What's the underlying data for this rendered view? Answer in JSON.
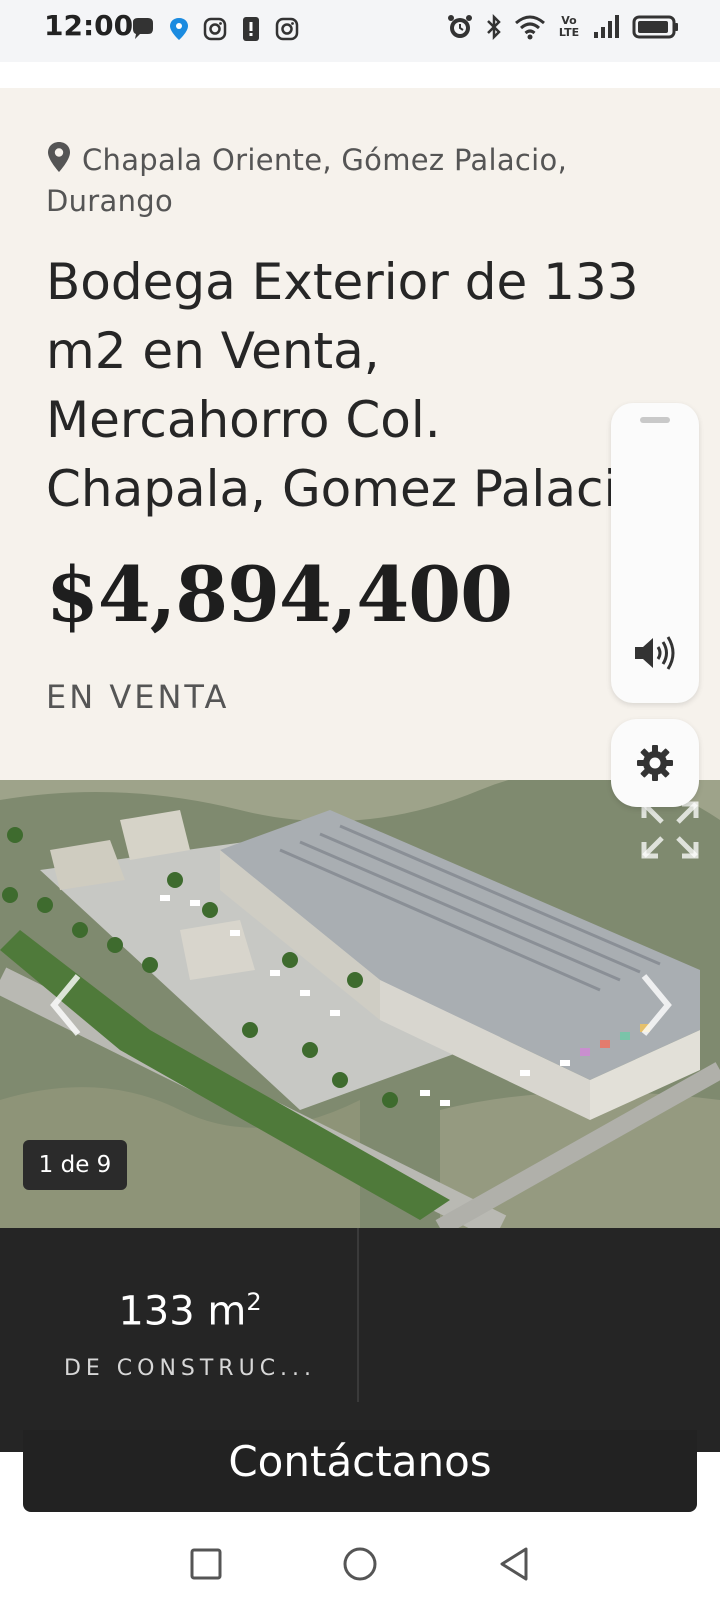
{
  "status_bar": {
    "time": "12:00",
    "left_icons": [
      "chat-icon",
      "location-drop-icon",
      "instagram-icon",
      "alert-icon",
      "instagram-icon"
    ],
    "right_icons": [
      "alarm-icon",
      "bluetooth-icon",
      "wifi-icon",
      "volte-icon",
      "signal-icon",
      "battery-icon"
    ],
    "volte_label": "Vo LTE"
  },
  "listing": {
    "location": "Chapala Oriente, Gómez Palacio, Durango",
    "title": "Bodega Exterior de 133 m2 en Venta, Mercahorro Col. Chapala, Gomez Palacio",
    "price": "$4,894,400",
    "status": "EN VENTA"
  },
  "gallery": {
    "counter": "1 de 9"
  },
  "stats": {
    "value_number": "133 m",
    "value_unit_sup": "2",
    "label": "DE CONSTRUC..."
  },
  "contact": {
    "label": "Contáctanos"
  },
  "colors": {
    "panel_bg": "#f6f2ec",
    "dark_bar": "#252525",
    "text": "#262626"
  }
}
